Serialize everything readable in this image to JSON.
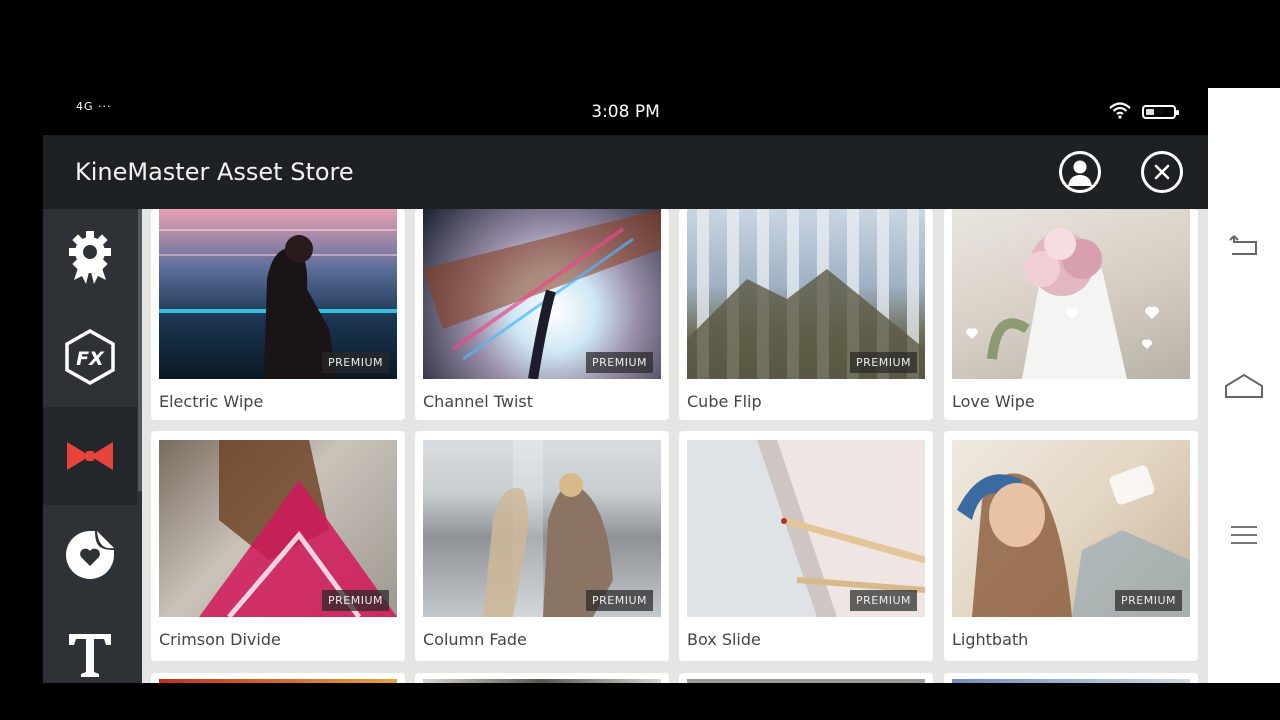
{
  "status": {
    "signal": "4G",
    "dots": "···",
    "time": "3:08 PM",
    "battery_level": "30",
    "battery_fraction": 0.3
  },
  "header": {
    "title": "KineMaster Asset Store"
  },
  "sidebar": {
    "items": [
      {
        "icon": "award-gear-icon"
      },
      {
        "icon": "fx-icon"
      },
      {
        "icon": "bowtie-transition-icon",
        "active": true
      },
      {
        "icon": "sticker-icon"
      },
      {
        "icon": "text-icon"
      }
    ]
  },
  "assets": [
    {
      "label": "Electric Wipe",
      "badge": "PREMIUM"
    },
    {
      "label": "Channel Twist",
      "badge": "PREMIUM"
    },
    {
      "label": "Cube Flip",
      "badge": "PREMIUM"
    },
    {
      "label": "Love Wipe",
      "badge": ""
    },
    {
      "label": "Crimson Divide",
      "badge": "PREMIUM"
    },
    {
      "label": "Column Fade",
      "badge": "PREMIUM"
    },
    {
      "label": "Box Slide",
      "badge": "PREMIUM"
    },
    {
      "label": "Lightbath",
      "badge": "PREMIUM"
    }
  ],
  "colors": {
    "header_bg": "#1d2124",
    "sidebar_bg": "#2e3236",
    "active_icon": "#e8433b",
    "content_bg": "#e5e6e4"
  }
}
